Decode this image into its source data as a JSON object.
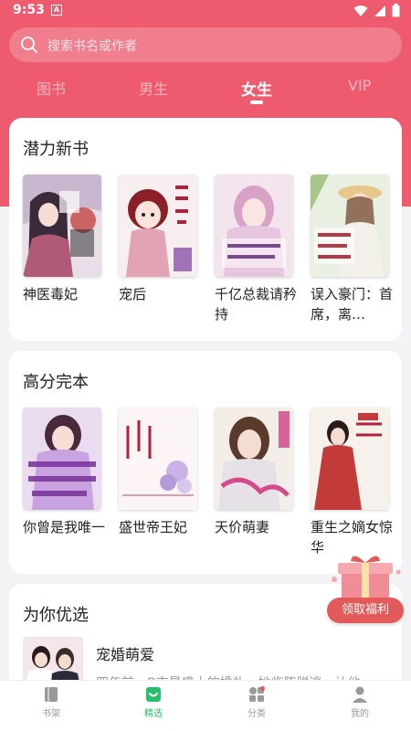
{
  "status": {
    "time": "9:53",
    "badge": "A"
  },
  "search": {
    "placeholder": "搜索书名或作者"
  },
  "tabs": [
    {
      "label": "图书"
    },
    {
      "label": "男生"
    },
    {
      "label": "女生",
      "active": true
    },
    {
      "label": "VIP"
    }
  ],
  "sections": [
    {
      "title": "潜力新书",
      "books": [
        {
          "title": "神医毒妃"
        },
        {
          "title": "宠后"
        },
        {
          "title": "千亿总裁请矜持"
        },
        {
          "title": "误入豪门：首席，离…"
        }
      ]
    },
    {
      "title": "高分完本",
      "books": [
        {
          "title": "你曾是我唯一"
        },
        {
          "title": "盛世帝王妃"
        },
        {
          "title": "天价萌妻"
        },
        {
          "title": "重生之嫡女惊华"
        }
      ]
    },
    {
      "title": "为你优选",
      "items": [
        {
          "title": "宠婚萌爱",
          "desc": "四年前，B市最盛大的婚礼，她临阵脱逃，让他"
        }
      ]
    }
  ],
  "gift": {
    "label": "领取福利"
  },
  "nav": [
    {
      "label": "书架",
      "icon": "bookshelf-icon"
    },
    {
      "label": "精选",
      "icon": "featured-icon",
      "active": true
    },
    {
      "label": "分类",
      "icon": "category-icon"
    },
    {
      "label": "我的",
      "icon": "profile-icon"
    }
  ],
  "colors": {
    "brand": "#ee5a6e",
    "active_nav": "#2bbd6e",
    "gift": "#e25a5a"
  }
}
